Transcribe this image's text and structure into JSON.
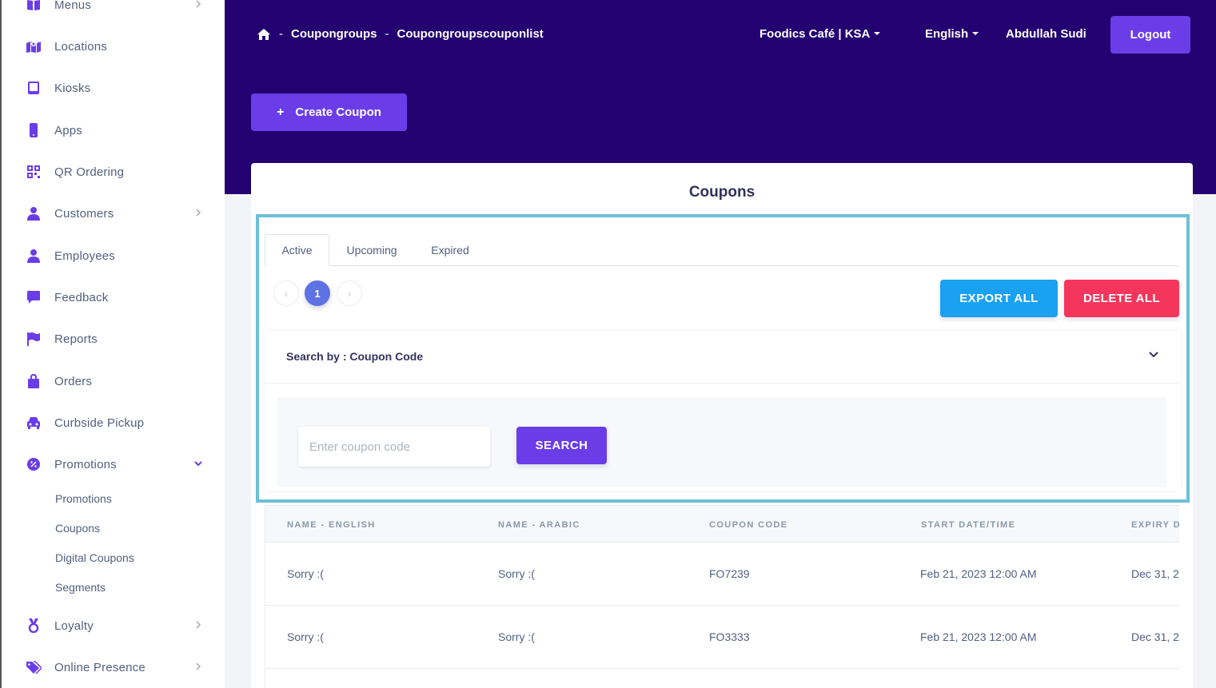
{
  "sidebar": {
    "items": [
      {
        "label": "Menus",
        "icon": "book-icon",
        "chevron": true
      },
      {
        "label": "Locations",
        "icon": "map-icon",
        "chevron": false
      },
      {
        "label": "Kiosks",
        "icon": "tablet-icon",
        "chevron": false
      },
      {
        "label": "Apps",
        "icon": "mobile-icon",
        "chevron": false
      },
      {
        "label": "QR Ordering",
        "icon": "qr-icon",
        "chevron": false
      },
      {
        "label": "Customers",
        "icon": "user-icon",
        "chevron": true
      },
      {
        "label": "Employees",
        "icon": "user-icon",
        "chevron": false
      },
      {
        "label": "Feedback",
        "icon": "comment-icon",
        "chevron": false
      },
      {
        "label": "Reports",
        "icon": "flag-icon",
        "chevron": false
      },
      {
        "label": "Orders",
        "icon": "shopping-bag-icon",
        "chevron": false
      },
      {
        "label": "Curbside Pickup",
        "icon": "car-icon",
        "chevron": false
      },
      {
        "label": "Promotions",
        "icon": "percent-badge-icon",
        "chevron": "down"
      }
    ],
    "promotions_sub": [
      "Promotions",
      "Coupons",
      "Digital Coupons",
      "Segments"
    ],
    "bottom_items": [
      {
        "label": "Loyalty",
        "icon": "medal-icon"
      },
      {
        "label": "Online Presence",
        "icon": "tags-icon"
      }
    ]
  },
  "header": {
    "breadcrumb": [
      "Coupongroups",
      "Coupongroupscouponlist"
    ],
    "breadcrumb_sep": "-",
    "business": "Foodics Café | KSA",
    "language": "English",
    "user": "Abdullah Sudi",
    "logout": "Logout",
    "create_coupon": "Create Coupon"
  },
  "card": {
    "title": "Coupons",
    "tabs": [
      "Active",
      "Upcoming",
      "Expired"
    ],
    "pagination": {
      "prev": "‹",
      "current": "1",
      "next": "›"
    },
    "export_all": "EXPORT ALL",
    "delete_all": "DELETE ALL",
    "search": {
      "title": "Search by : Coupon Code",
      "placeholder": "Enter coupon code",
      "button": "SEARCH"
    },
    "table": {
      "headers": [
        "NAME - ENGLISH",
        "NAME - ARABIC",
        "COUPON CODE",
        "START DATE/TIME",
        "EXPIRY D"
      ],
      "rows": [
        [
          "Sorry :(",
          "Sorry :(",
          "FO7239",
          "Feb 21, 2023 12:00 AM",
          "Dec 31, 2"
        ],
        [
          "Sorry :(",
          "Sorry :(",
          "FO3333",
          "Feb 21, 2023 12:00 AM",
          "Dec 31, 2"
        ]
      ]
    }
  },
  "colors": {
    "header_bg": "#230171",
    "primary": "#6a3de8",
    "export": "#1aa1f2",
    "delete": "#f5365c",
    "highlight": "#6cc0d6"
  }
}
